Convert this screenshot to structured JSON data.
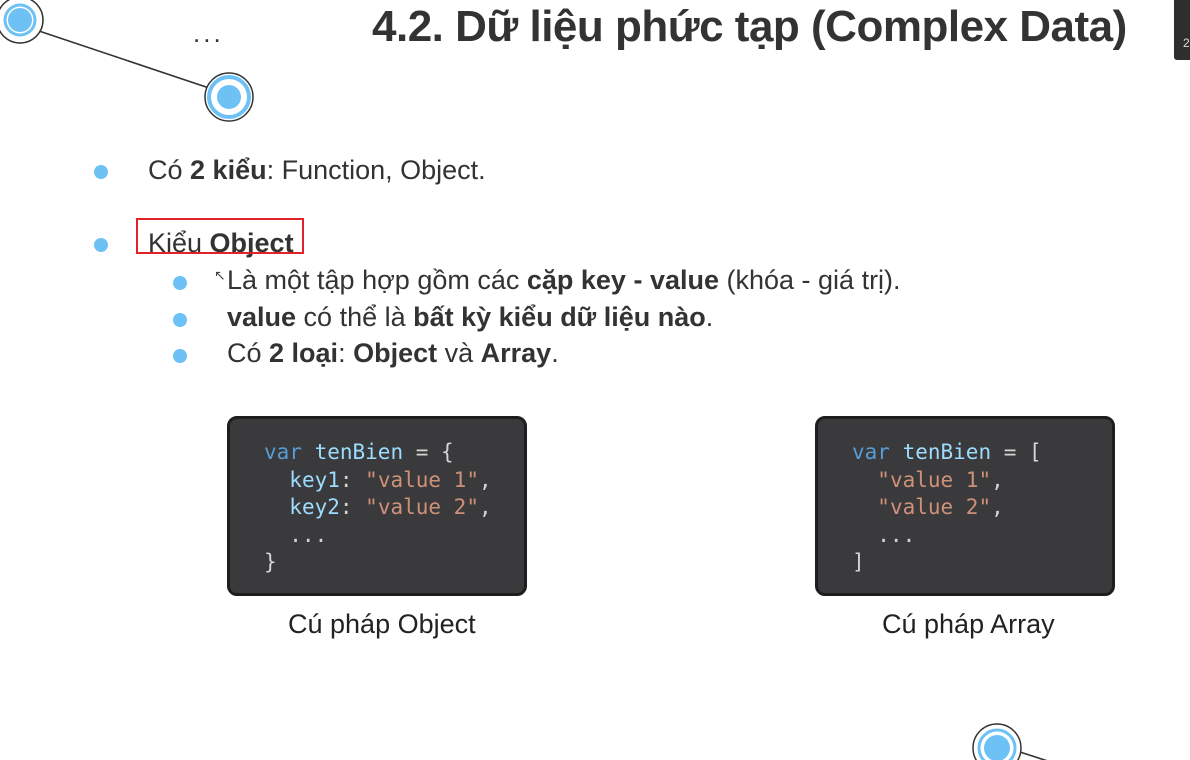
{
  "slide": {
    "title": "4.2. Dữ liệu phức tạp (Complex Data)",
    "ellipsis": "...",
    "thumb_label": "2"
  },
  "bullets": {
    "b1": {
      "pre": "Có ",
      "bold": "2 kiểu",
      "post": ": Function, Object."
    },
    "b2": {
      "pre": "Kiểu ",
      "bold": "Object"
    },
    "s1": {
      "pre": "Là một tập hợp gồm các ",
      "bold": "cặp key - value",
      "post": " (khóa - giá trị)."
    },
    "s2": {
      "bold1": "value",
      "mid": " có thể là ",
      "bold2": "bất kỳ kiểu dữ liệu nào",
      "post": "."
    },
    "s3": {
      "pre": "Có ",
      "bold1": "2 loại",
      "mid1": ": ",
      "bold2": "Object",
      "mid2": " và ",
      "bold3": "Array",
      "post": "."
    }
  },
  "code_object": {
    "l1_kw": "var",
    "l1_var": "tenBien",
    "l1_rest": " = {",
    "l2_key": "key1",
    "l2_sep": ": ",
    "l2_str": "\"value 1\"",
    "l2_end": ",",
    "l3_key": "key2",
    "l3_sep": ": ",
    "l3_str": "\"value 2\"",
    "l3_end": ",",
    "l4": "  ...",
    "l5": "}",
    "caption": "Cú pháp Object"
  },
  "code_array": {
    "l1_kw": "var",
    "l1_var": "tenBien",
    "l1_rest": " = [",
    "l2_str": "\"value 1\"",
    "l2_end": ",",
    "l3_str": "\"value 2\"",
    "l3_end": ",",
    "l4": "  ...",
    "l5": "]",
    "caption": "Cú pháp Array"
  },
  "colors": {
    "accent": "#6ec1f5",
    "highlight": "#e0232b",
    "code_bg": "#3a3a3c"
  }
}
